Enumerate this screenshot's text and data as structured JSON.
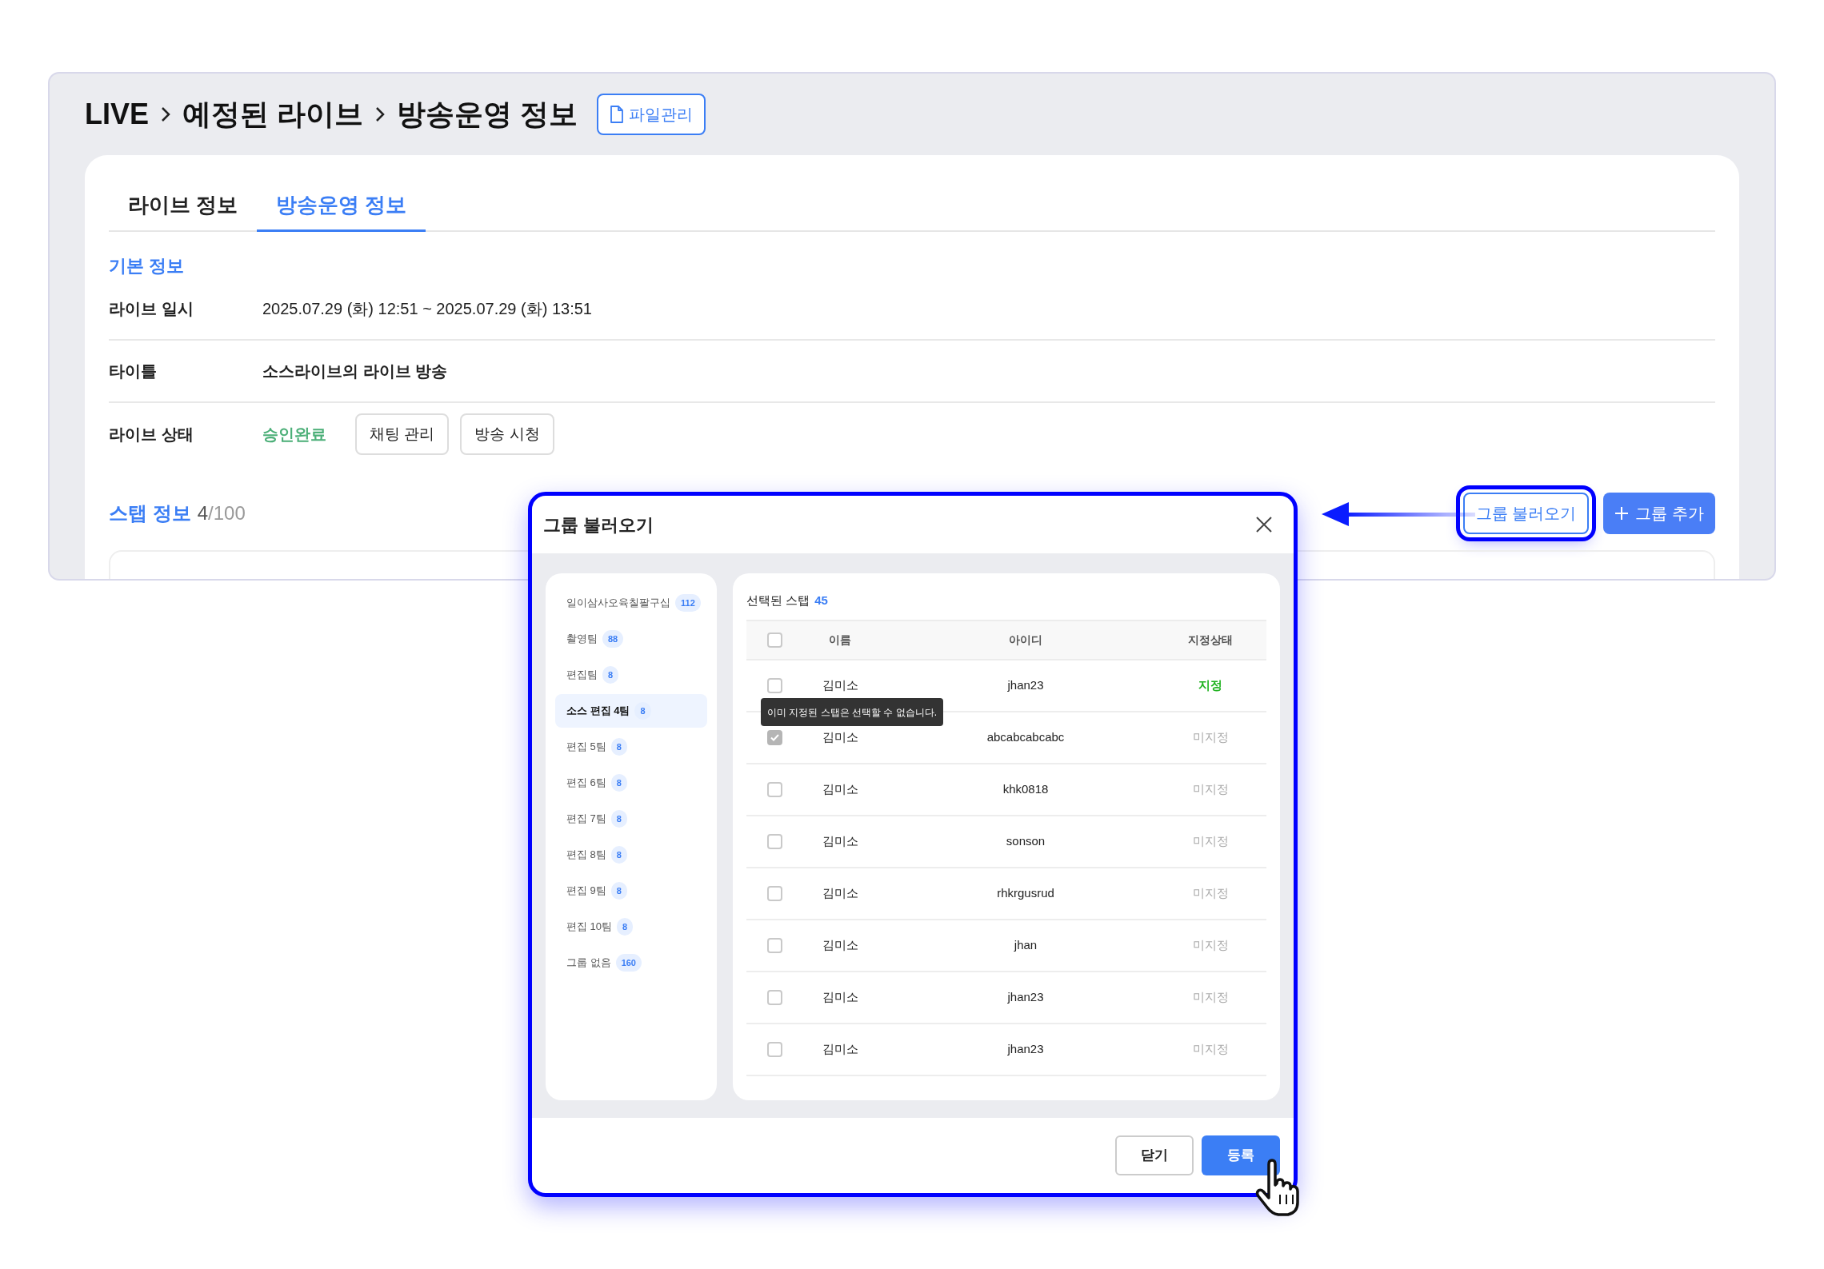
{
  "breadcrumb": [
    "LIVE",
    "예정된 라이브",
    "방송운영 정보"
  ],
  "file_button": "파일관리",
  "tabs": [
    {
      "label": "라이브 정보",
      "selected": false
    },
    {
      "label": "방송운영 정보",
      "selected": true
    }
  ],
  "section_title": "기본 정보",
  "info_rows": [
    {
      "kind": "text",
      "label": "라이브 일시",
      "value": "2025.07.29 (화) 12:51 ~ 2025.07.29 (화) 13:51"
    },
    {
      "kind": "bold",
      "label": "타이틀",
      "value": "소스라이브의 라이브 방송"
    },
    {
      "kind": "status",
      "label": "라이브 상태",
      "value": "승인완료",
      "buttons": [
        "채팅 관리",
        "방송 시청"
      ]
    }
  ],
  "staff": {
    "title": "스탭 정보",
    "count": "4",
    "limit": "/100"
  },
  "staff_buttons": [
    {
      "kind": "outline",
      "label": "그룹 불러오기",
      "highlighted": true
    },
    {
      "kind": "primary",
      "label": "그룹 추가",
      "highlighted": false
    }
  ],
  "modal": {
    "title": "그룹 불러오기",
    "groups": [
      {
        "name": "일이삼사오육칠팔구십",
        "count": "112",
        "selected": false
      },
      {
        "name": "촬영팀",
        "count": "88",
        "selected": false
      },
      {
        "name": "편집팀",
        "count": "8",
        "selected": false
      },
      {
        "name": "소스 편집 4팀",
        "count": "8",
        "selected": true
      },
      {
        "name": "편집 5팀",
        "count": "8",
        "selected": false
      },
      {
        "name": "편집 6팀",
        "count": "8",
        "selected": false
      },
      {
        "name": "편집 7팀",
        "count": "8",
        "selected": false
      },
      {
        "name": "편집 8팀",
        "count": "8",
        "selected": false
      },
      {
        "name": "편집 9팀",
        "count": "8",
        "selected": false
      },
      {
        "name": "편집 10팀",
        "count": "8",
        "selected": false
      },
      {
        "name": "그룹 없음",
        "count": "160",
        "selected": false
      }
    ],
    "selected_label": "선택된 스탭",
    "selected_count": "45",
    "columns": [
      "이름",
      "아이디",
      "지정상태"
    ],
    "header_checked": false,
    "rows": [
      {
        "checked": false,
        "name": "김미소",
        "id": "jhan23",
        "status": "지정",
        "assigned": true
      },
      {
        "checked": true,
        "name": "김미소",
        "id": "abcabcabcabc",
        "status": "미지정",
        "assigned": false
      },
      {
        "checked": false,
        "name": "김미소",
        "id": "khk0818",
        "status": "미지정",
        "assigned": false
      },
      {
        "checked": false,
        "name": "김미소",
        "id": "sonson",
        "status": "미지정",
        "assigned": false
      },
      {
        "checked": false,
        "name": "김미소",
        "id": "rhkrgusrud",
        "status": "미지정",
        "assigned": false
      },
      {
        "checked": false,
        "name": "김미소",
        "id": "jhan",
        "status": "미지정",
        "assigned": false
      },
      {
        "checked": false,
        "name": "김미소",
        "id": "jhan23",
        "status": "미지정",
        "assigned": false
      },
      {
        "checked": false,
        "name": "김미소",
        "id": "jhan23",
        "status": "미지정",
        "assigned": false
      }
    ],
    "tooltip": "이미 지정된 스탭은 선택할 수 없습니다.",
    "buttons": [
      {
        "kind": "secondary",
        "label": "닫기"
      },
      {
        "kind": "primary",
        "label": "등록"
      }
    ]
  }
}
